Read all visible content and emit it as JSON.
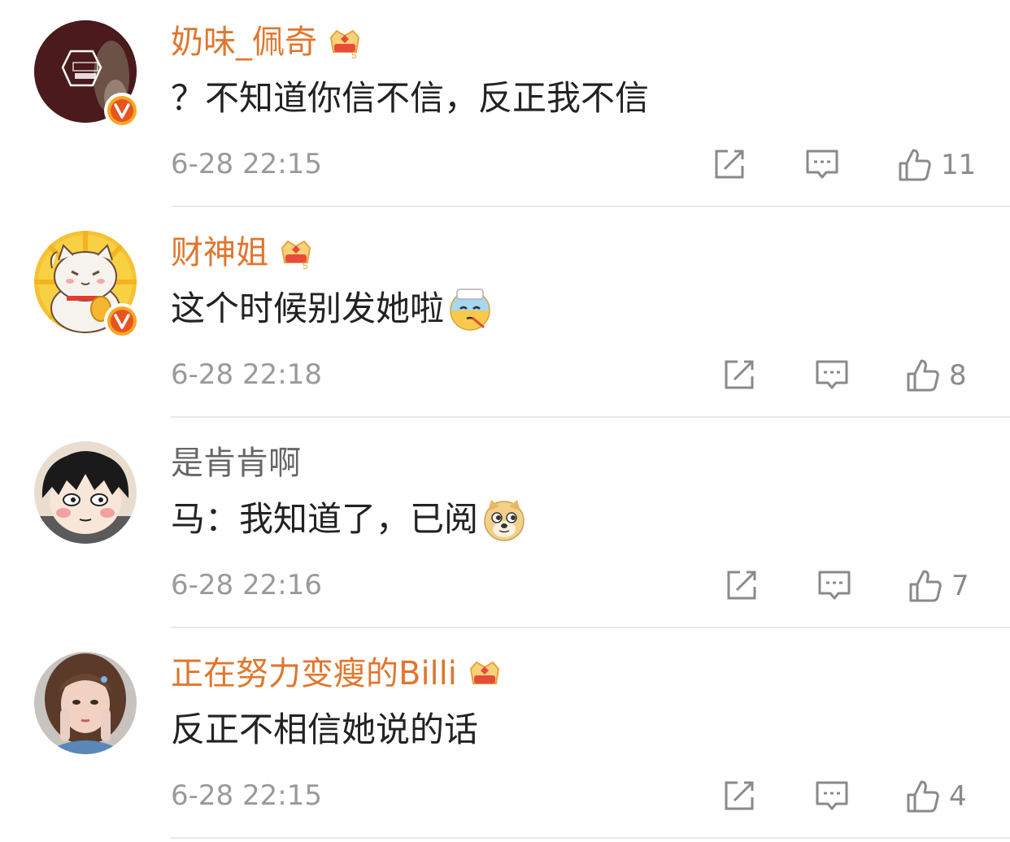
{
  "comments": [
    {
      "username": "奶味_佩奇",
      "text": "？不知道你信不信，反正我不信",
      "time": "6-28 22:15",
      "likes": "11",
      "verified": true,
      "vip": true,
      "avatar_icon": "nwps-logo-avatar"
    },
    {
      "username": "财神姐",
      "text": "这个时候别发她啦",
      "emoji": "sick-face-emoji",
      "time": "6-28 22:18",
      "likes": "8",
      "verified": true,
      "vip": true,
      "avatar_icon": "lucky-cat-avatar"
    },
    {
      "username": "是肯肯啊",
      "text": "马：我知道了，已阅",
      "emoji": "doge-emoji",
      "time": "6-28 22:16",
      "likes": "7",
      "verified": false,
      "vip": false,
      "avatar_icon": "cartoon-girl-avatar"
    },
    {
      "username": "正在努力变瘦的Billi",
      "text": "反正不相信她说的话",
      "time": "6-28 22:15",
      "likes": "4",
      "verified": false,
      "vip": true,
      "avatar_icon": "girl-photo-avatar"
    }
  ],
  "colors": {
    "vip_name": "#e0762e",
    "plain_name": "#666666",
    "text": "#222222",
    "meta": "#9a9a9a",
    "divider": "#e8e8e8"
  }
}
